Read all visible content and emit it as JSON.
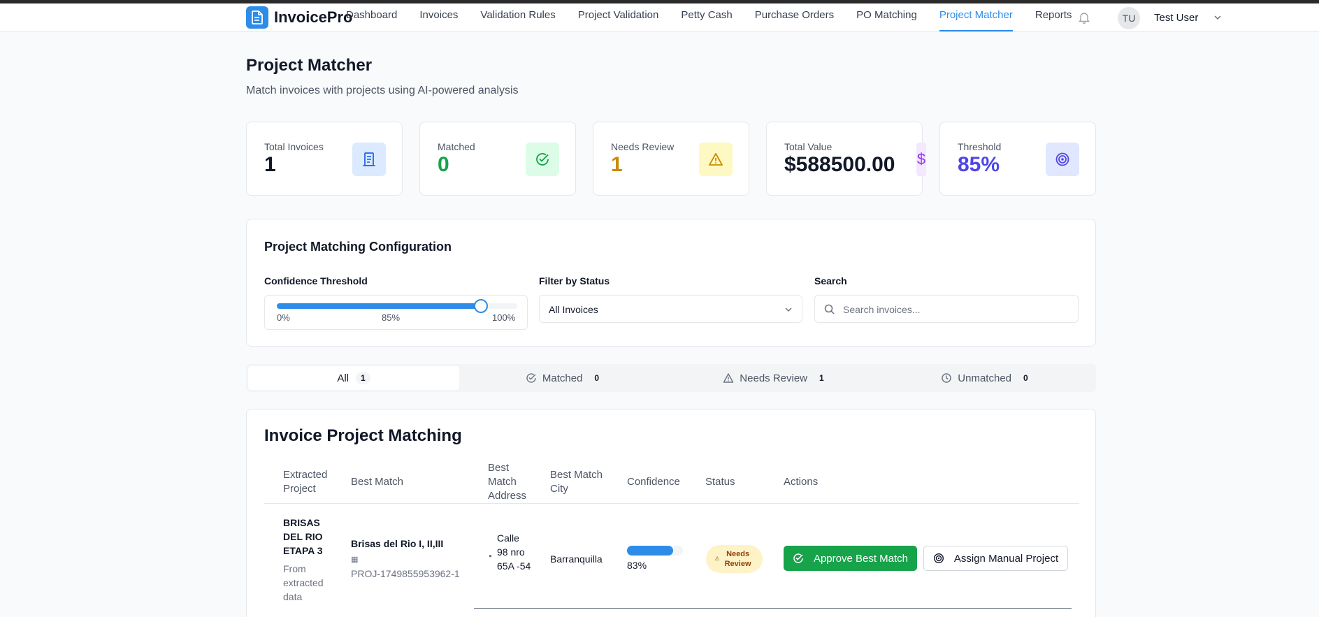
{
  "app": {
    "name": "InvoicePro"
  },
  "nav": {
    "items": [
      {
        "label": "Dashboard"
      },
      {
        "label": "Invoices"
      },
      {
        "label": "Validation Rules"
      },
      {
        "label": "Project Validation"
      },
      {
        "label": "Petty Cash"
      },
      {
        "label": "Purchase Orders"
      },
      {
        "label": "PO Matching"
      },
      {
        "label": "Project Matcher",
        "active": true
      },
      {
        "label": "Reports"
      }
    ]
  },
  "user": {
    "initials": "TU",
    "name": "Test User"
  },
  "page": {
    "title": "Project Matcher",
    "subtitle": "Match invoices with projects using AI-powered analysis"
  },
  "stats": [
    {
      "label": "Total Invoices",
      "value": "1",
      "icon": "document-icon",
      "color": "#111827",
      "icon_bg": "#dbeafe"
    },
    {
      "label": "Matched",
      "value": "0",
      "icon": "check-circle-icon",
      "color": "#16a34a",
      "icon_bg": "#dcfce7"
    },
    {
      "label": "Needs Review",
      "value": "1",
      "icon": "warning-icon",
      "color": "#ca8a04",
      "icon_bg": "#fef9c3"
    },
    {
      "label": "Total Value",
      "value": "$588500.00",
      "icon": "dollar-icon",
      "color": "#111827",
      "icon_bg": "#f3e8ff"
    },
    {
      "label": "Threshold",
      "value": "85%",
      "icon": "target-icon",
      "color": "#4f46e5",
      "icon_bg": "#e0e7ff"
    }
  ],
  "config": {
    "title": "Project Matching Configuration",
    "threshold_label": "Confidence Threshold",
    "threshold_value": 0.85,
    "slider_min": "0%",
    "slider_mid": "85%",
    "slider_max": "100%",
    "status_label": "Filter by Status",
    "status_selected": "All Invoices",
    "search_label": "Search",
    "search_placeholder": "Search invoices..."
  },
  "tabs": [
    {
      "label": "All",
      "count": "1",
      "icon": ""
    },
    {
      "label": "Matched",
      "count": "0",
      "icon": "check-circle-icon"
    },
    {
      "label": "Needs Review",
      "count": "1",
      "icon": "warning-icon"
    },
    {
      "label": "Unmatched",
      "count": "0",
      "icon": "clock-icon"
    }
  ],
  "table": {
    "title": "Invoice Project Matching",
    "columns": {
      "extracted": "Extracted Project",
      "best_match": "Best Match",
      "address": "Best Match Address",
      "city": "Best Match City",
      "confidence": "Confidence",
      "status": "Status",
      "actions": "Actions"
    },
    "rows": [
      {
        "extracted_project": "BRISAS DEL RIO ETAPA 3",
        "extracted_note": "From extracted data",
        "best_match": "Brisas del Rio I, II,III",
        "project_id": "PROJ-1749855953962-1",
        "address": "Calle 98 nro 65A -54",
        "city": "Barranquilla",
        "confidence": 0.83,
        "confidence_label": "83%",
        "status": "Needs Review",
        "approve_label": "Approve Best Match",
        "assign_label": "Assign Manual Project"
      }
    ]
  }
}
